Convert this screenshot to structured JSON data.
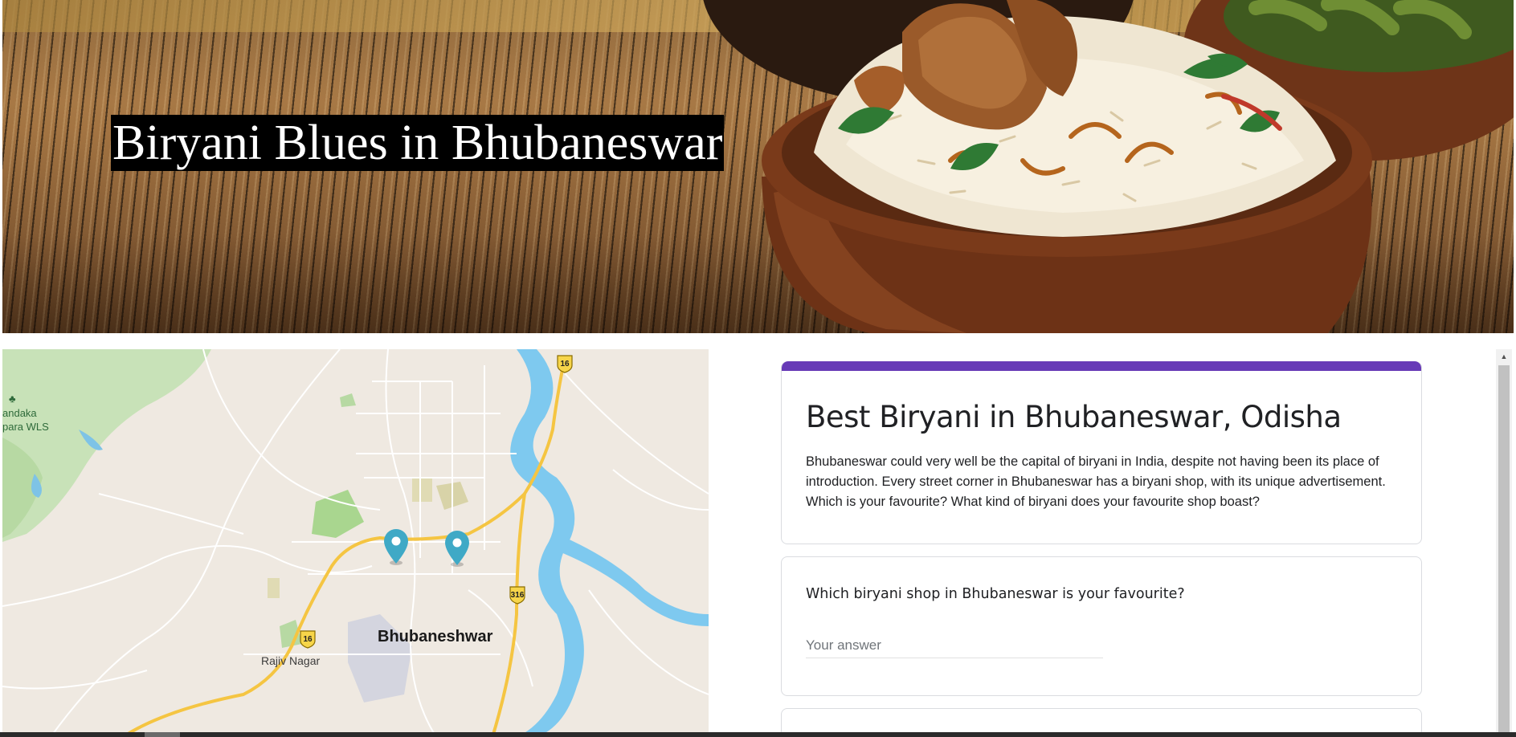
{
  "hero": {
    "title": "Biryani Blues in Bhubaneswar"
  },
  "map": {
    "city_label": "Bhubaneshwar",
    "locality_label": "Rajiv Nagar",
    "park_label_line1": "andaka",
    "park_label_line2": "para WLS",
    "highway_labels": [
      "16",
      "316",
      "16"
    ],
    "pin_color": "#3fa9c6"
  },
  "form": {
    "accent_color": "#673ab7",
    "title": "Best Biryani in Bhubaneswar, Odisha",
    "description": "Bhubaneswar could very well be the capital of biryani in India, despite not having been its place of introduction. Every street corner in Bhubaneswar has a biryani shop, with its unique advertisement. Which is your favourite? What kind of biryani does your favourite shop boast?",
    "question_1": {
      "title": "Which biryani shop in Bhubaneswar is your favourite?",
      "placeholder": "Your answer"
    }
  }
}
